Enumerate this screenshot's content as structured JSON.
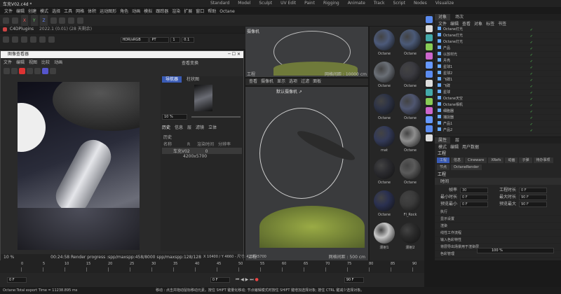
{
  "top": {
    "title": "车充V02.c4d *",
    "menus": [
      "文件",
      "编辑",
      "创建",
      "模式",
      "选择",
      "工具",
      "网格",
      "体积",
      "运动图形",
      "角色",
      "动画",
      "模拟",
      "跟踪器",
      "渲染",
      "扩展",
      "窗口",
      "帮助",
      "Octane"
    ],
    "layouts": [
      "Standard",
      "Model",
      "Sculpt",
      "UV Edit",
      "Paint",
      "Rigging",
      "Animate",
      "Track",
      "Script",
      "Nodes",
      "Visualize"
    ]
  },
  "toolbar": {
    "xyz": [
      "X",
      "Y",
      "Z"
    ],
    "color": "HDR/sRGB",
    "preset": "PT",
    "num1": "1",
    "num2": "0.1"
  },
  "plugin": {
    "label": "C4DPlugins",
    "version": "2022.1 (0.01) (28 天剩余)"
  },
  "viewer": {
    "title": "图像查看器",
    "menus": [
      "文件",
      "编辑",
      "视图",
      "比较",
      "动画"
    ],
    "status": "00:24:58 Render progress :spp/maxspp:458/8000  spp/maxspp:128/128",
    "zoom": "10 %",
    "nav_tabs": [
      "导航器",
      "柱状图"
    ],
    "zoom2": "10 %",
    "hist_tabs": [
      "历史",
      "信息",
      "层",
      "滤镜",
      "立体"
    ],
    "hist_label": "历史",
    "hist_cols": [
      "名称",
      "R",
      "渲染时间",
      "分辨率"
    ],
    "hist_row": {
      "name": "车充V02",
      "r": "0",
      "res": "4200x5700"
    },
    "sidebar_btn": "查看变换"
  },
  "vp_top": {
    "label": "摄像机",
    "menus": [
      "查看",
      "摄像机",
      "显示",
      "选项",
      "过滤",
      "面板"
    ],
    "cam": "默认摄像机 ↗",
    "grid": "网格间距 : 10000 cm",
    "workplane": "工程"
  },
  "vp_main": {
    "menus": [
      "查看",
      "摄像机",
      "显示",
      "选项",
      "过滤",
      "面板"
    ],
    "cam": "默认摄像机 ↗",
    "grid": "网格间距 : 500 cm",
    "coord": "X 10400 / Y 4660 - 尺寸: 4200x5700",
    "workplane": "工程"
  },
  "materials": [
    {
      "name": "Octane",
      "color": "#4c5a7a"
    },
    {
      "name": "Octane",
      "color": "#4b5a78"
    },
    {
      "name": "Octane",
      "color": "#6a6f76"
    },
    {
      "name": "Octane",
      "color": "#3a3a40"
    },
    {
      "name": "Octane",
      "color": "#2d3346"
    },
    {
      "name": "Octane",
      "color": "#4f5670"
    },
    {
      "name": "mat",
      "color": "#333a58"
    },
    {
      "name": "Octane",
      "color": "#8e8e8e"
    },
    {
      "name": "Octane",
      "color": "#2b2b2f"
    },
    {
      "name": "Octane",
      "color": "#5b5b5b"
    },
    {
      "name": "Octane",
      "color": "#2a3050"
    },
    {
      "name": "Fl_Rock",
      "color": "#3a3a3a"
    },
    {
      "name": "漫射1",
      "color": "#c8c8c8"
    },
    {
      "name": "漫射2",
      "color": "#2a2a2a"
    }
  ],
  "objects": {
    "tabs": [
      "对象",
      "场次"
    ],
    "menus": [
      "文件",
      "编辑",
      "查看",
      "对象",
      "标签",
      "书签"
    ],
    "items": [
      "Octane灯光",
      "Octane灯光",
      "Octane灯光",
      "产品",
      "以放材光",
      "月亮",
      "星球1",
      "星球2",
      "飞碟1",
      "飞碟",
      "星球",
      "Octane天空",
      "Octane相机",
      "细胞器",
      "捕捉器",
      "产品1",
      "产品2"
    ]
  },
  "attrs": {
    "tabs": [
      "属性",
      "层"
    ],
    "menus": [
      "模式",
      "编辑",
      "用户数据"
    ],
    "obj": "工程",
    "subtabs": [
      "工程",
      "信息",
      "Cineware",
      "XRefs",
      "动画",
      "子弹",
      "待办事项",
      "节点",
      "OctaneRender"
    ],
    "section": "工程",
    "sub": "时间",
    "fields": [
      {
        "l": "帧率",
        "v": "30"
      },
      {
        "l": "工程时长",
        "v": "0 F"
      },
      {
        "l": "最小时长",
        "v": "0 F"
      },
      {
        "l": "最大时长",
        "v": "90 F"
      },
      {
        "l": "预览最小",
        "v": "0 F"
      },
      {
        "l": "预览最大",
        "v": "90 F"
      }
    ],
    "rows": [
      "执行",
      "显示设置",
      "渲染",
      "线性工作流程",
      "输入色彩特性",
      "将层导出场景用于渲染层",
      "色彩管理"
    ],
    "pct": "100 %"
  },
  "timeline": {
    "ticks": [
      "0",
      "5",
      "10",
      "15",
      "20",
      "25",
      "30",
      "35",
      "40",
      "45",
      "50",
      "55",
      "60",
      "65",
      "70",
      "75",
      "80",
      "85",
      "90"
    ],
    "frame": "0 F",
    "end": "90 F",
    "start": "0 F",
    "pos": "0 F"
  },
  "statusbar": "移动 : 点击并拖动鼠标移动元素。按住 SHIFT 键量化移动; 节点编辑模式时按住 SHIFT 键增加选择对象; 按住 CTRL 键减少选择对象。",
  "statusleft": "Octane:Total export Time = 11238.895 ms"
}
